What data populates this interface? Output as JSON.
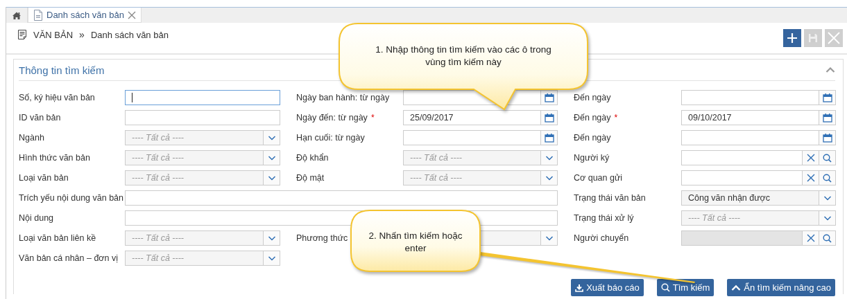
{
  "tabs": [
    {
      "kind": "home",
      "selected": false
    },
    {
      "kind": "page",
      "label": "Danh sách văn bản",
      "selected": true,
      "closable": true
    }
  ],
  "breadcrumb": {
    "items": [
      "VĂN BẢN",
      "Danh sách văn bản"
    ],
    "separator": "»"
  },
  "toolbar": [
    {
      "kind": "add",
      "disabled": false
    },
    {
      "kind": "save",
      "disabled": true
    },
    {
      "kind": "close",
      "disabled": true
    }
  ],
  "search_panel": {
    "title": "Thông tin tìm kiếm",
    "expanded": true,
    "fields": [
      {
        "label": "Số, ký hiệu văn bản",
        "kind": "text",
        "focused": true
      },
      {
        "label": "Ngày ban hành: từ ngày",
        "kind": "date"
      },
      {
        "label": "Đến ngày",
        "kind": "date"
      },
      {
        "label": "ID văn bản",
        "kind": "text",
        "focused": false
      },
      {
        "label": "Ngày đến: từ ngày",
        "kind": "date",
        "required_mark": "*",
        "value": "25/09/2017"
      },
      {
        "label": "Đến ngày",
        "kind": "date",
        "required_mark": "*",
        "value": "09/10/2017"
      },
      {
        "label": "Ngành",
        "kind": "select",
        "placeholder": "---- Tất cả ----"
      },
      {
        "label": "Hạn cuối: từ ngày",
        "kind": "date"
      },
      {
        "label": "Đến ngày",
        "kind": "date"
      },
      {
        "label": "Hình thức văn bản",
        "kind": "select",
        "placeholder": "---- Tất cả ----"
      },
      {
        "label": "Độ khẩn",
        "kind": "select",
        "placeholder": "---- Tất cả ----"
      },
      {
        "label": "Người ký",
        "kind": "lookup",
        "disabled": false
      },
      {
        "label": "Loại văn bản",
        "kind": "select",
        "placeholder": "---- Tất cả ----"
      },
      {
        "label": "Độ mật",
        "kind": "select",
        "placeholder": "---- Tất cả ----"
      },
      {
        "label": "Cơ quan gửi",
        "kind": "lookup",
        "disabled": false
      },
      {
        "label": "Trích yếu nội dung văn bản",
        "kind": "wide"
      },
      {
        "label": "Trạng thái văn bản",
        "kind": "select",
        "value": "Công văn nhận được"
      },
      {
        "label": "Nội dung",
        "kind": "wide"
      },
      {
        "label": "Trạng thái xử lý",
        "kind": "select",
        "placeholder": "---- Tất cả ----"
      },
      {
        "label": "Loại văn bản liên kề",
        "kind": "select",
        "placeholder": "---- Tất cả ----"
      },
      {
        "label": "Phương thức",
        "kind": "select"
      },
      {
        "label": "Người chuyển",
        "kind": "lookup",
        "disabled": true
      },
      {
        "label": "Văn bản cá nhân – đơn vị",
        "kind": "select",
        "placeholder": "---- Tất cả ----"
      }
    ],
    "actions": [
      {
        "kind": "export",
        "label": "Xuất báo cáo"
      },
      {
        "kind": "search",
        "label": "Tìm kiếm"
      },
      {
        "kind": "collapse",
        "label": "Ẩn tìm kiếm nâng cao"
      }
    ]
  },
  "callouts": [
    {
      "text": "1. Nhập thông tin tìm kiếm vào các ô trong vùng tìm kiếm này"
    },
    {
      "text": "2. Nhấn tìm kiếm hoặc enter"
    }
  ]
}
